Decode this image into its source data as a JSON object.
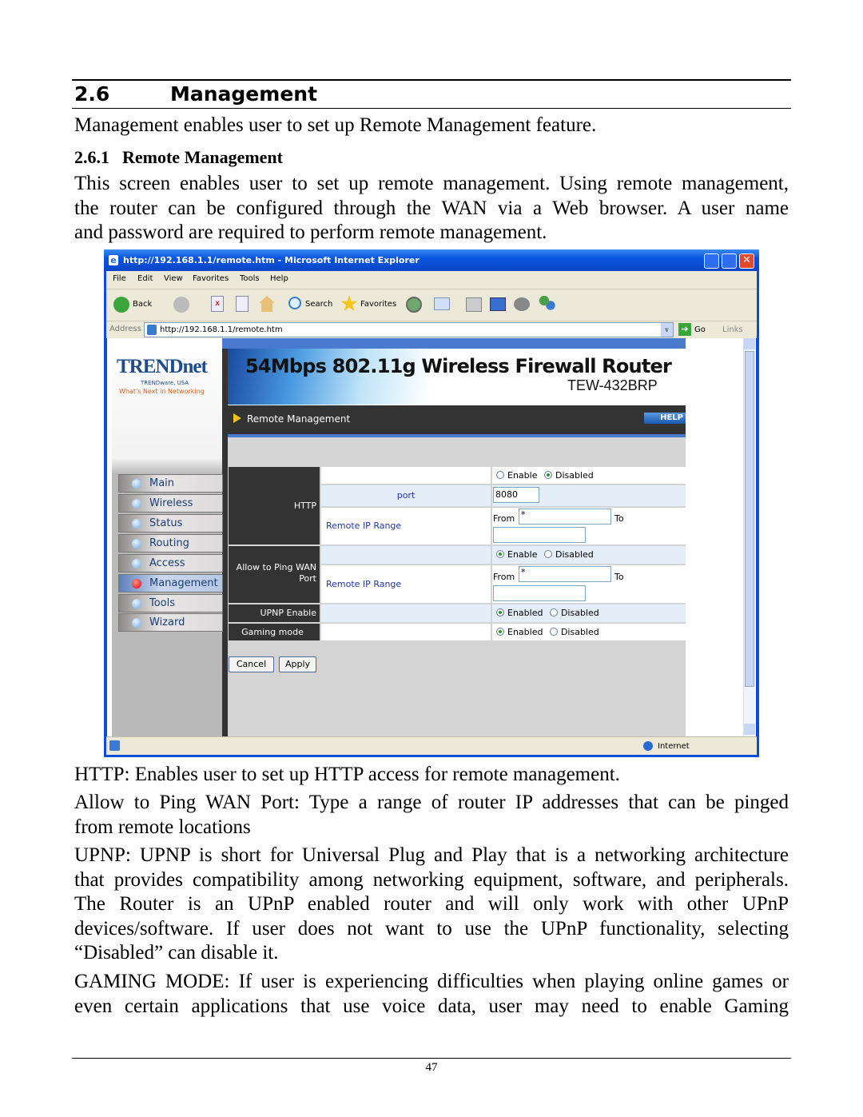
{
  "section": {
    "number": "2.6",
    "title": "Management",
    "intro": "Management enables user to set up Remote Management feature."
  },
  "subsection": {
    "number": "2.6.1",
    "title": "Remote Management",
    "lines": [
      "This screen enables user to set up remote management. Using remote management,",
      "the router can be configured through the WAN via a Web browser. A user name",
      "and password are required to perform remote management."
    ]
  },
  "browser": {
    "title": "http://192.168.1.1/remote.htm - Microsoft Internet Explorer",
    "menu": [
      "File",
      "Edit",
      "View",
      "Favorites",
      "Tools",
      "Help"
    ],
    "toolbar": {
      "back": "Back",
      "search": "Search",
      "favorites": "Favorites"
    },
    "address_label": "Address",
    "address": "http://192.168.1.1/remote.htm",
    "go": "Go",
    "links": "Links",
    "status": "Internet"
  },
  "router": {
    "logo": {
      "brand": "TRENDnet",
      "sub": "TRENDware, USA",
      "tagline": "What's Next in Networking"
    },
    "banner_title": "54Mbps 802.11g Wireless Firewall Router",
    "model": "TEW-432BRP",
    "page_title": "Remote Management",
    "help": "HELP",
    "nav": [
      "Main",
      "Wireless",
      "Status",
      "Routing",
      "Access",
      "Management",
      "Tools",
      "Wizard"
    ],
    "active_nav": "Management",
    "http": {
      "label": "HTTP",
      "enable": "Enable",
      "disabled": "Disabled",
      "selected": "Disabled",
      "port_label": "port",
      "port": "8080",
      "range_label": "Remote IP Range",
      "from": "From",
      "to": "To",
      "from_value": "*",
      "to_value": ""
    },
    "ping": {
      "label": "Allow to Ping WAN Port",
      "enable": "Enable",
      "disabled": "Disabled",
      "selected": "Enable",
      "range_label": "Remote IP Range",
      "from": "From",
      "to": "To",
      "from_value": "*",
      "to_value": ""
    },
    "upnp": {
      "label": "UPNP Enable",
      "enabled": "Enabled",
      "disabled": "Disabled",
      "selected": "Enabled"
    },
    "gaming": {
      "label": "Gaming mode",
      "enabled": "Enabled",
      "disabled": "Disabled",
      "selected": "Enabled"
    },
    "cancel": "Cancel",
    "apply": "Apply"
  },
  "descriptions": {
    "http": [
      "HTTP: Enables user to set up HTTP access for remote management."
    ],
    "ping": [
      "Allow to Ping WAN Port: Type a range of router IP addresses that can be pinged",
      "from remote locations"
    ],
    "upnp": [
      "UPNP: UPNP is short for Universal Plug and Play that is a networking architecture",
      "that provides compatibility among networking equipment, software, and peripherals.",
      "The Router is an UPnP enabled router and will only work with other UPnP",
      "devices/software. If user does not want to use the UPnP functionality, selecting",
      "“Disabled” can disable it."
    ],
    "gaming": [
      "GAMING MODE: If user is experiencing difficulties when playing online games or",
      "even certain applications that use voice data, user may need to enable Gaming"
    ]
  },
  "page_number": "47"
}
